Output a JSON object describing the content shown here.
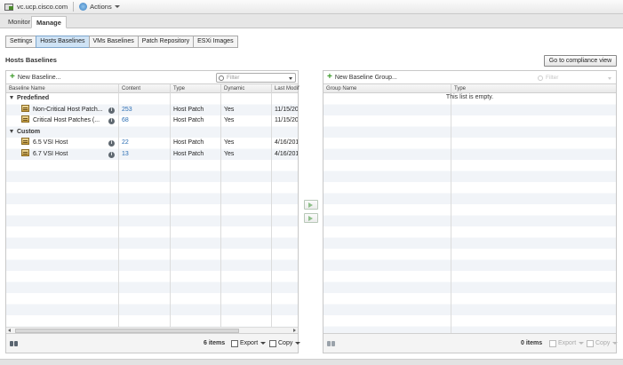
{
  "header": {
    "host": "vc.ucp.cisco.com",
    "actions_label": "Actions"
  },
  "primary_tabs": [
    {
      "label": "Monitor"
    },
    {
      "label": "Manage"
    }
  ],
  "sub_tabs": [
    {
      "label": "Settings"
    },
    {
      "label": "Hosts Baselines"
    },
    {
      "label": "VMs Baselines"
    },
    {
      "label": "Patch Repository"
    },
    {
      "label": "ESXi Images"
    }
  ],
  "section_title": "Hosts Baselines",
  "compliance_button": "Go to compliance view",
  "left_panel": {
    "new_label": "New Baseline...",
    "filter_placeholder": "Filter",
    "columns": [
      "Baseline Name",
      "Content",
      "Type",
      "Dynamic",
      "Last Modif"
    ],
    "groups": [
      {
        "label": "Predefined",
        "rows": [
          {
            "name": "Non-Critical Host Patch...",
            "content": "253",
            "type": "Host Patch",
            "dynamic": "Yes",
            "modified": "11/15/20"
          },
          {
            "name": "Critical Host Patches (...",
            "content": "68",
            "type": "Host Patch",
            "dynamic": "Yes",
            "modified": "11/15/20"
          }
        ]
      },
      {
        "label": "Custom",
        "rows": [
          {
            "name": "6.5 VSI Host",
            "content": "22",
            "type": "Host Patch",
            "dynamic": "Yes",
            "modified": "4/16/201"
          },
          {
            "name": "6.7 VSI Host",
            "content": "13",
            "type": "Host Patch",
            "dynamic": "Yes",
            "modified": "4/16/201"
          }
        ]
      }
    ],
    "item_count": "6 items",
    "export_label": "Export",
    "copy_label": "Copy"
  },
  "right_panel": {
    "new_label": "New Baseline Group...",
    "filter_placeholder": "Filter",
    "columns": [
      "Group Name",
      "Type"
    ],
    "empty_message": "This list is empty.",
    "item_count": "0 items",
    "export_label": "Export",
    "copy_label": "Copy"
  },
  "colors": {
    "accent": "#2a6db3",
    "tab_active": "#cfe3f5",
    "add_green": "#3c9a2a"
  }
}
